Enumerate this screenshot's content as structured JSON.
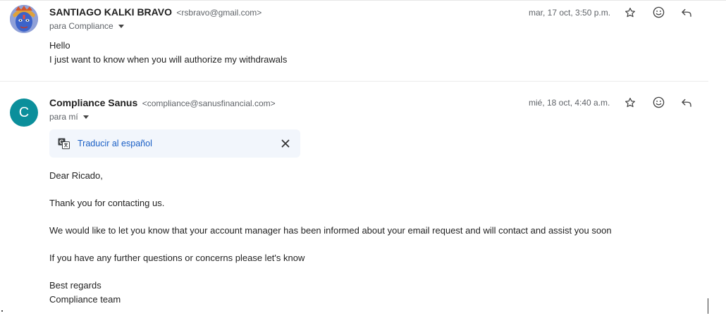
{
  "messages": [
    {
      "sender_name": "SANTIAGO KALKI BRAVO",
      "sender_email": "<rsbravo@gmail.com>",
      "recipient": "para Compliance",
      "date": "mar, 17 oct, 3:50 p.m.",
      "body": [
        "Hello",
        "I just want to know when you will authorize my withdrawals"
      ]
    },
    {
      "avatar_letter": "C",
      "sender_name": "Compliance Sanus",
      "sender_email": "<compliance@sanusfinancial.com>",
      "recipient": "para mí",
      "date": "mié, 18 oct, 4:40 a.m.",
      "translate_label": "Traducir al español",
      "body": [
        "Dear Ricado,",
        "Thank you for contacting us.",
        "We would like to let you know that your account manager has been informed about your email request and will contact and assist you soon",
        "If you have any further questions or concerns please let's know",
        "Best regards",
        "Compliance team"
      ]
    }
  ],
  "icons": {
    "star": "star-icon",
    "emoji": "emoji-icon",
    "reply": "reply-icon",
    "translate": "translate-icon",
    "close": "close-icon",
    "caret": "chevron-down-icon"
  },
  "colors": {
    "avatar_teal": "#0b8f9b",
    "link_blue": "#1a5fc5",
    "translate_bg": "#f2f6fc"
  }
}
